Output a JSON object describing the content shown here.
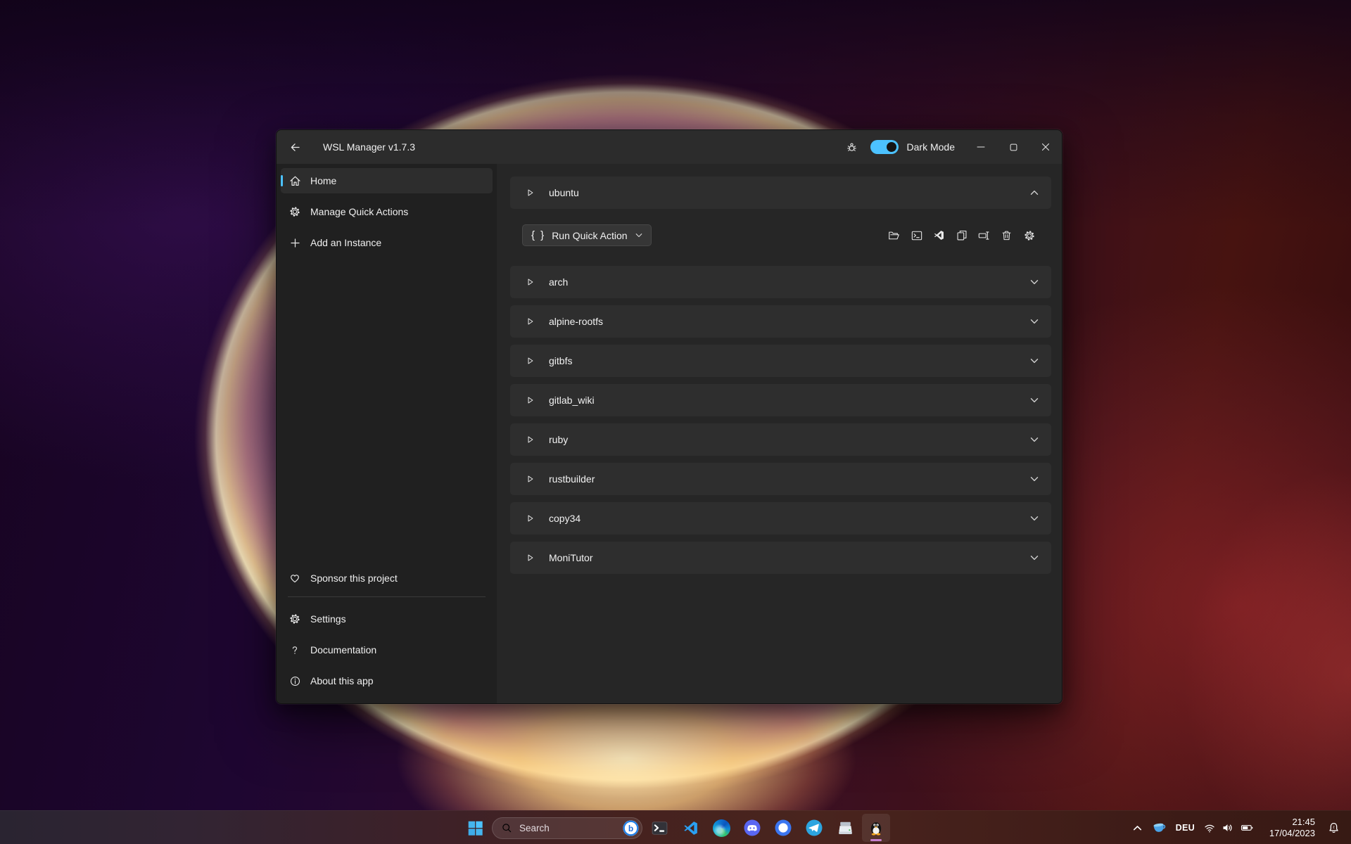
{
  "window": {
    "title": "WSL Manager v1.7.3",
    "titlebar": {
      "dark_mode_label": "Dark Mode",
      "dark_mode_on": true
    },
    "sidebar": {
      "items": [
        {
          "label": "Home",
          "icon": "home",
          "selected": true
        },
        {
          "label": "Manage Quick Actions",
          "icon": "gear"
        },
        {
          "label": "Add an Instance",
          "icon": "plus"
        }
      ],
      "bottom_items": [
        {
          "label": "Sponsor this project",
          "icon": "heart"
        },
        {
          "divider": true
        },
        {
          "label": "Settings",
          "icon": "gear"
        },
        {
          "label": "Documentation",
          "icon": "question"
        },
        {
          "label": "About this app",
          "icon": "info"
        }
      ]
    },
    "main": {
      "quick_action_label": "Run Quick Action",
      "toolbar_actions": [
        "open-folder",
        "open-terminal",
        "open-vscode",
        "duplicate",
        "rename",
        "delete",
        "instance-settings"
      ],
      "instances": [
        {
          "label": "ubuntu",
          "expanded": true
        },
        {
          "label": "arch"
        },
        {
          "label": "alpine-rootfs"
        },
        {
          "label": "gitbfs"
        },
        {
          "label": "gitlab_wiki"
        },
        {
          "label": "ruby"
        },
        {
          "label": "rustbuilder"
        },
        {
          "label": "copy34"
        },
        {
          "label": "MoniTutor"
        }
      ]
    }
  },
  "taskbar": {
    "search_placeholder": "Search",
    "apps": [
      {
        "name": "windows-terminal"
      },
      {
        "name": "vscode"
      },
      {
        "name": "edge"
      },
      {
        "name": "discord"
      },
      {
        "name": "signal"
      },
      {
        "name": "telegram"
      },
      {
        "name": "scanner"
      },
      {
        "name": "wsl-manager",
        "active": true
      }
    ],
    "tray": {
      "language": "DEU",
      "time": "21:45",
      "date": "17/04/2023"
    }
  },
  "colors": {
    "accent": "#4cc2ff",
    "titlebar_bg": "#2c2c2c",
    "sidebar_bg": "#202020",
    "window_bg": "#262626",
    "row_bg": "#2e2e2e",
    "taskbar_active_underline": "#c780cf"
  }
}
